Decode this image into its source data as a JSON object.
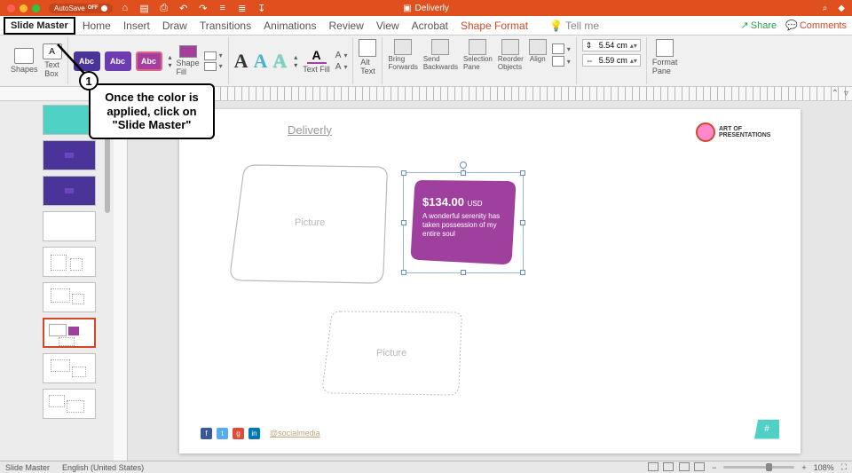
{
  "titlebar": {
    "autosave": "AutoSave",
    "autosave_state": "OFF",
    "document": "Deliverly",
    "search_icon": "⌕",
    "user_icon": "◆"
  },
  "tabs": {
    "slide_master": "Slide Master",
    "list": [
      "Home",
      "Insert",
      "Draw",
      "Transitions",
      "Animations",
      "Review",
      "View",
      "Acrobat",
      "Shape Format"
    ],
    "tellme": "Tell me",
    "share": "Share",
    "comments": "Comments"
  },
  "ribbon": {
    "shapes": "Shapes",
    "textbox": "Text\nBox",
    "abc": "Abc",
    "shapefill": "Shape\nFill",
    "textfill": "Text Fill",
    "alttext": "Alt\nText",
    "bringfwd": "Bring\nForwards",
    "sendback": "Send\nBackwards",
    "selpane": "Selection\nPane",
    "reorder": "Reorder\nObjects",
    "align": "Align",
    "height": "5.54 cm",
    "width": "5.59 cm",
    "formatpane": "Format\nPane"
  },
  "slide": {
    "title": "Deliverly",
    "logo_text": "ART OF\nPRESENTATIONS",
    "price": "$134.00",
    "currency": "USD",
    "desc": "A wonderful serenity has taken possession of my entire soul",
    "placeholder": "Picture",
    "social_handle": "@socialmedia",
    "slidenum": "#"
  },
  "statusbar": {
    "view": "Slide Master",
    "lang": "English (United States)",
    "zoom": "108%"
  },
  "annotation": {
    "num": "1",
    "text": "Once the color is applied, click on \"Slide Master\""
  }
}
